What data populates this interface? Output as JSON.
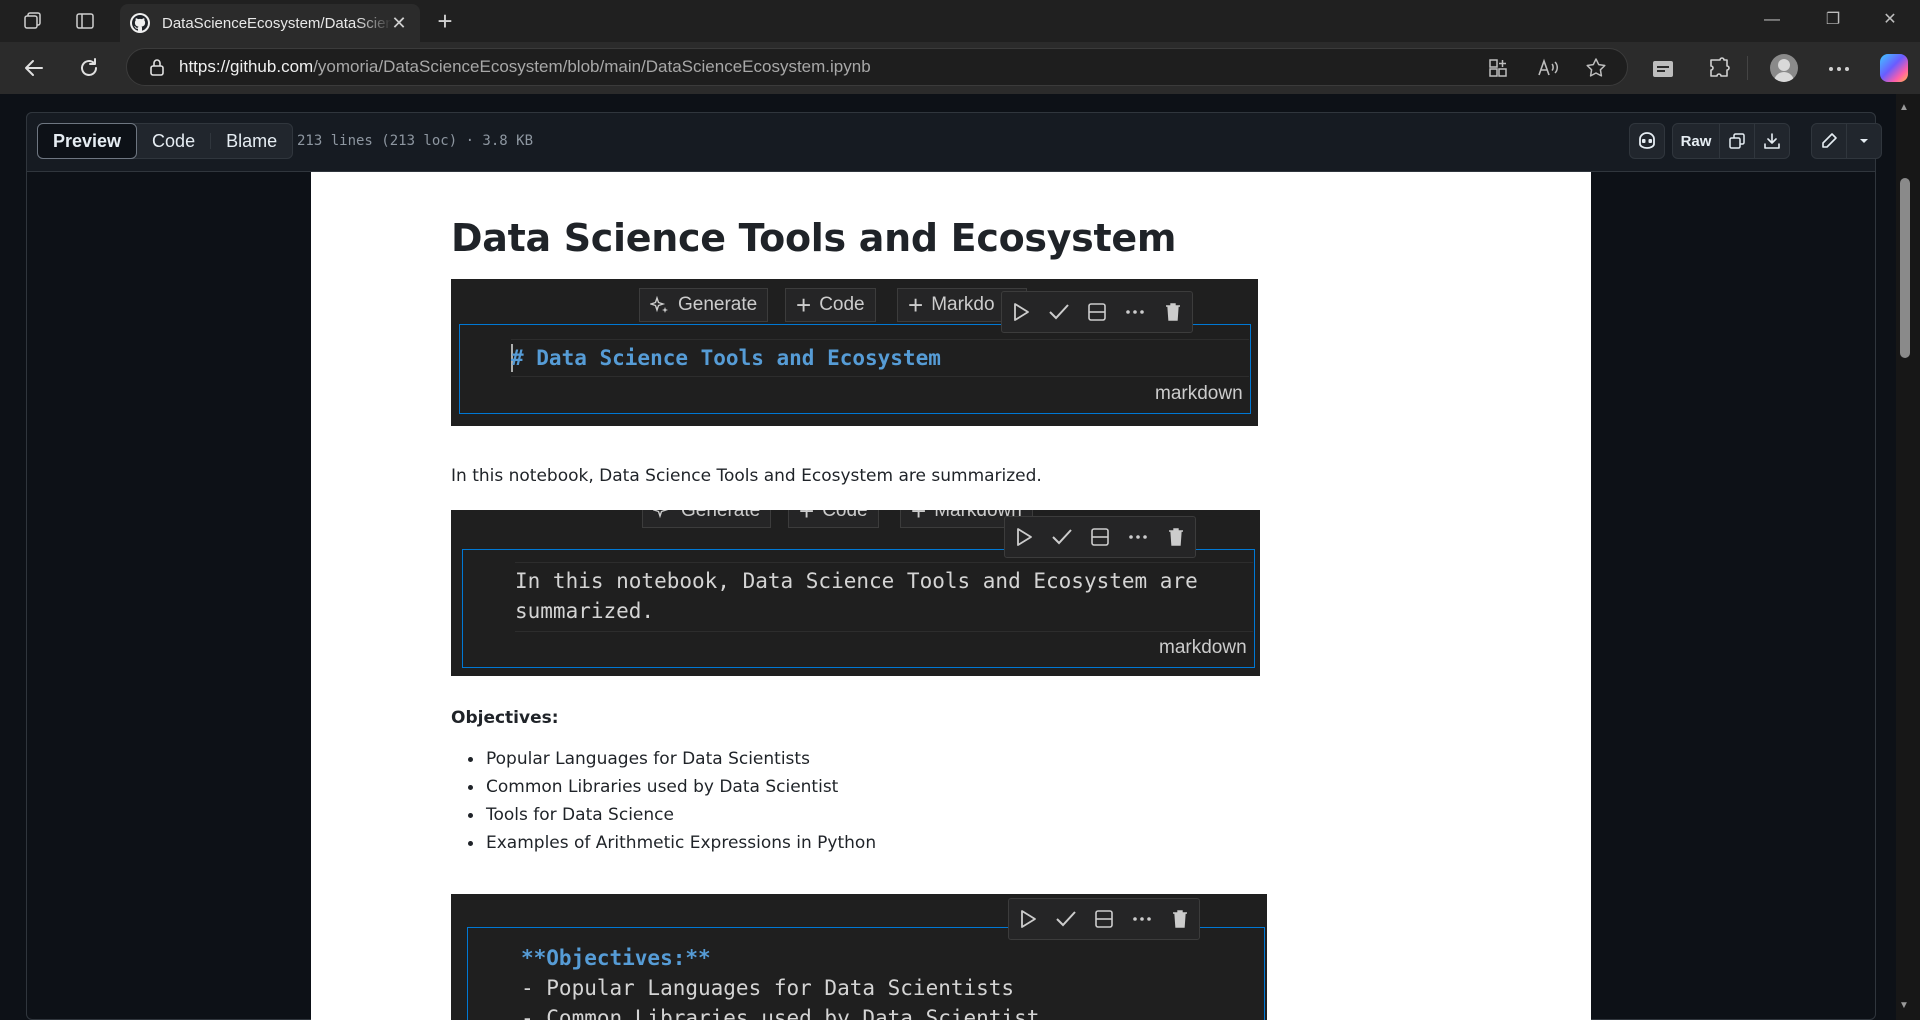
{
  "browser": {
    "tab_title": "DataScienceEcosystem/DataScienceEcosystem.ipynb",
    "url_host": "https://github.com",
    "url_path": "/yomoria/DataScienceEcosystem/blob/main/DataScienceEcosystem.ipynb",
    "close_glyph": "✕",
    "newtab_glyph": "+",
    "window_controls": {
      "minimize": "—",
      "maximize": "❐",
      "close": "✕"
    }
  },
  "file_header": {
    "tabs": [
      "Preview",
      "Code",
      "Blame"
    ],
    "active_tab": "Preview",
    "info": "213 lines (213 loc) · 3.8 KB",
    "raw_label": "Raw"
  },
  "notebook": {
    "title": "Data Science Tools and Ecosystem",
    "cell_toolbar": {
      "generate": "Generate",
      "code": "Code",
      "markdown": "Markdown",
      "markdown_truncated": "Markdo"
    },
    "cell1": {
      "source": "# Data Science Tools and Ecosystem",
      "lang": "markdown"
    },
    "intro": "In this notebook, Data Science Tools and Ecosystem are summarized.",
    "cell2": {
      "line1": "In this notebook, Data Science Tools and Ecosystem are",
      "line2": "summarized.",
      "lang": "markdown"
    },
    "objectives_heading": "Objectives:",
    "objectives": [
      "Popular Languages for Data Scientists",
      "Common Libraries used by Data Scientist",
      "Tools for Data Science",
      "Examples of Arithmetic Expressions in Python"
    ],
    "cell3": {
      "line1": "**Objectives:**",
      "line2": "- Popular Languages for Data Scientists",
      "line3": "- Common Libraries used by Data Scientist"
    }
  }
}
